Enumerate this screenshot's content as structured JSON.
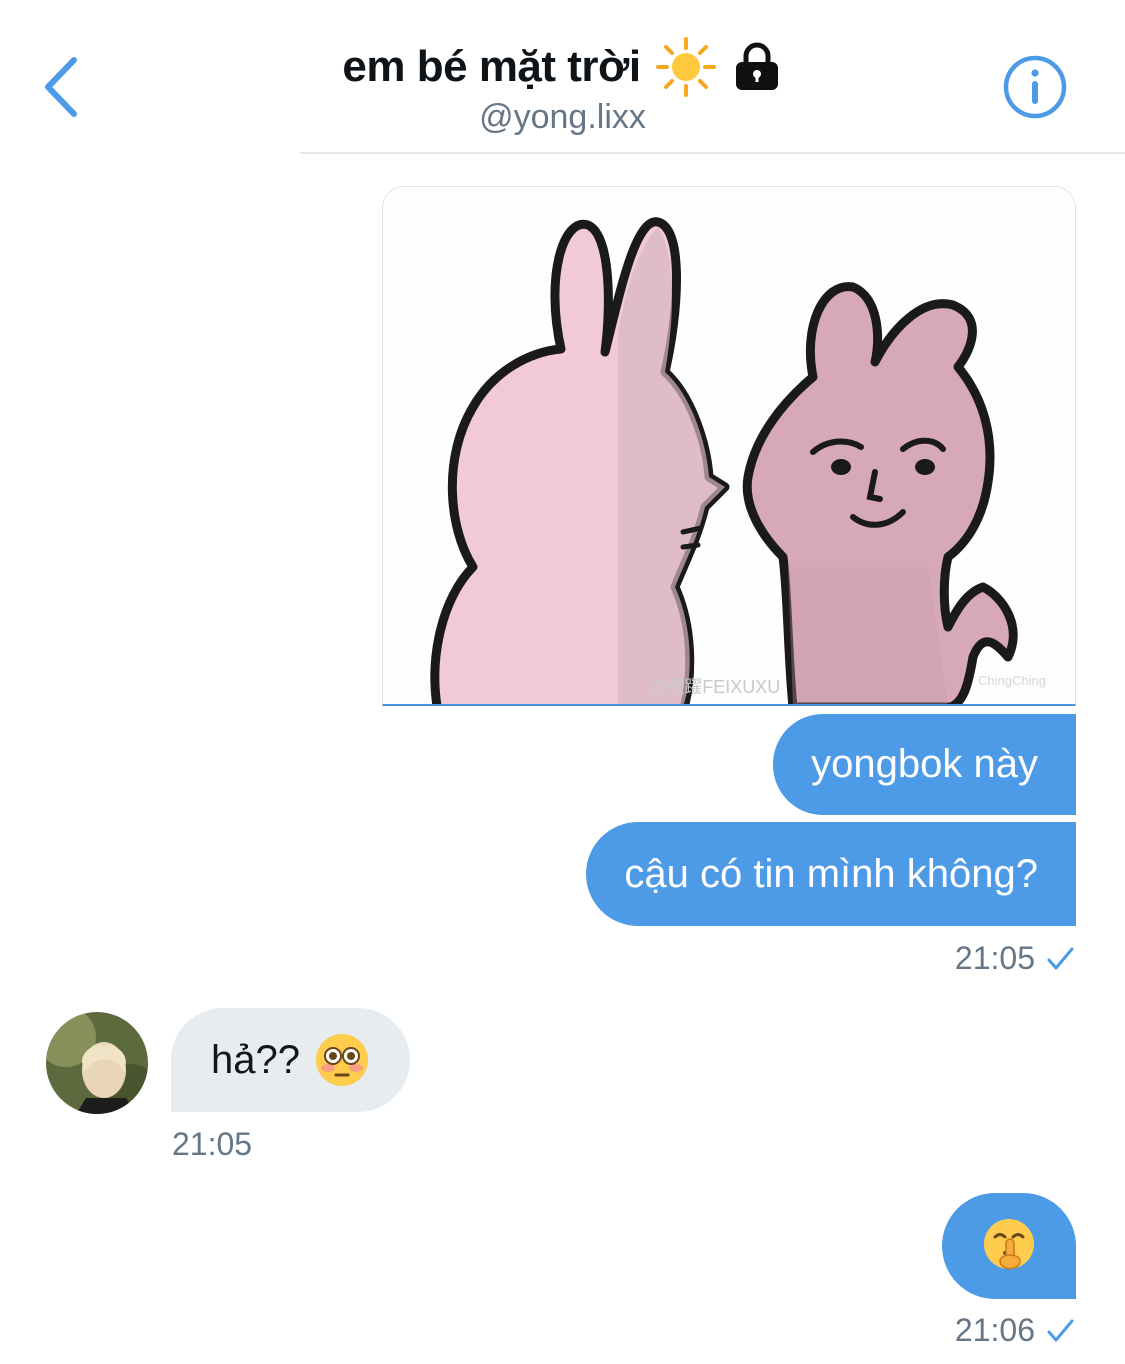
{
  "header": {
    "title": "em bé mặt trời",
    "handle": "@yong.lixx",
    "icons": [
      "back-chevron-icon",
      "sun-icon",
      "lock-icon",
      "info-icon"
    ]
  },
  "messages": {
    "sent_image": {
      "watermark_left": "@飛躍FEIXUXU",
      "watermark_right": "ChingChing"
    },
    "sent_1": "yongbok này",
    "sent_2": "cậu có tin mình không?",
    "sent_time_1": "21:05",
    "received_1": "hả??",
    "received_time_1": "21:05",
    "sent_time_2": "21:06"
  },
  "colors": {
    "accent": "#4d9be6",
    "incoming_bubble": "#e6ecf0",
    "meta_text": "#657786"
  }
}
